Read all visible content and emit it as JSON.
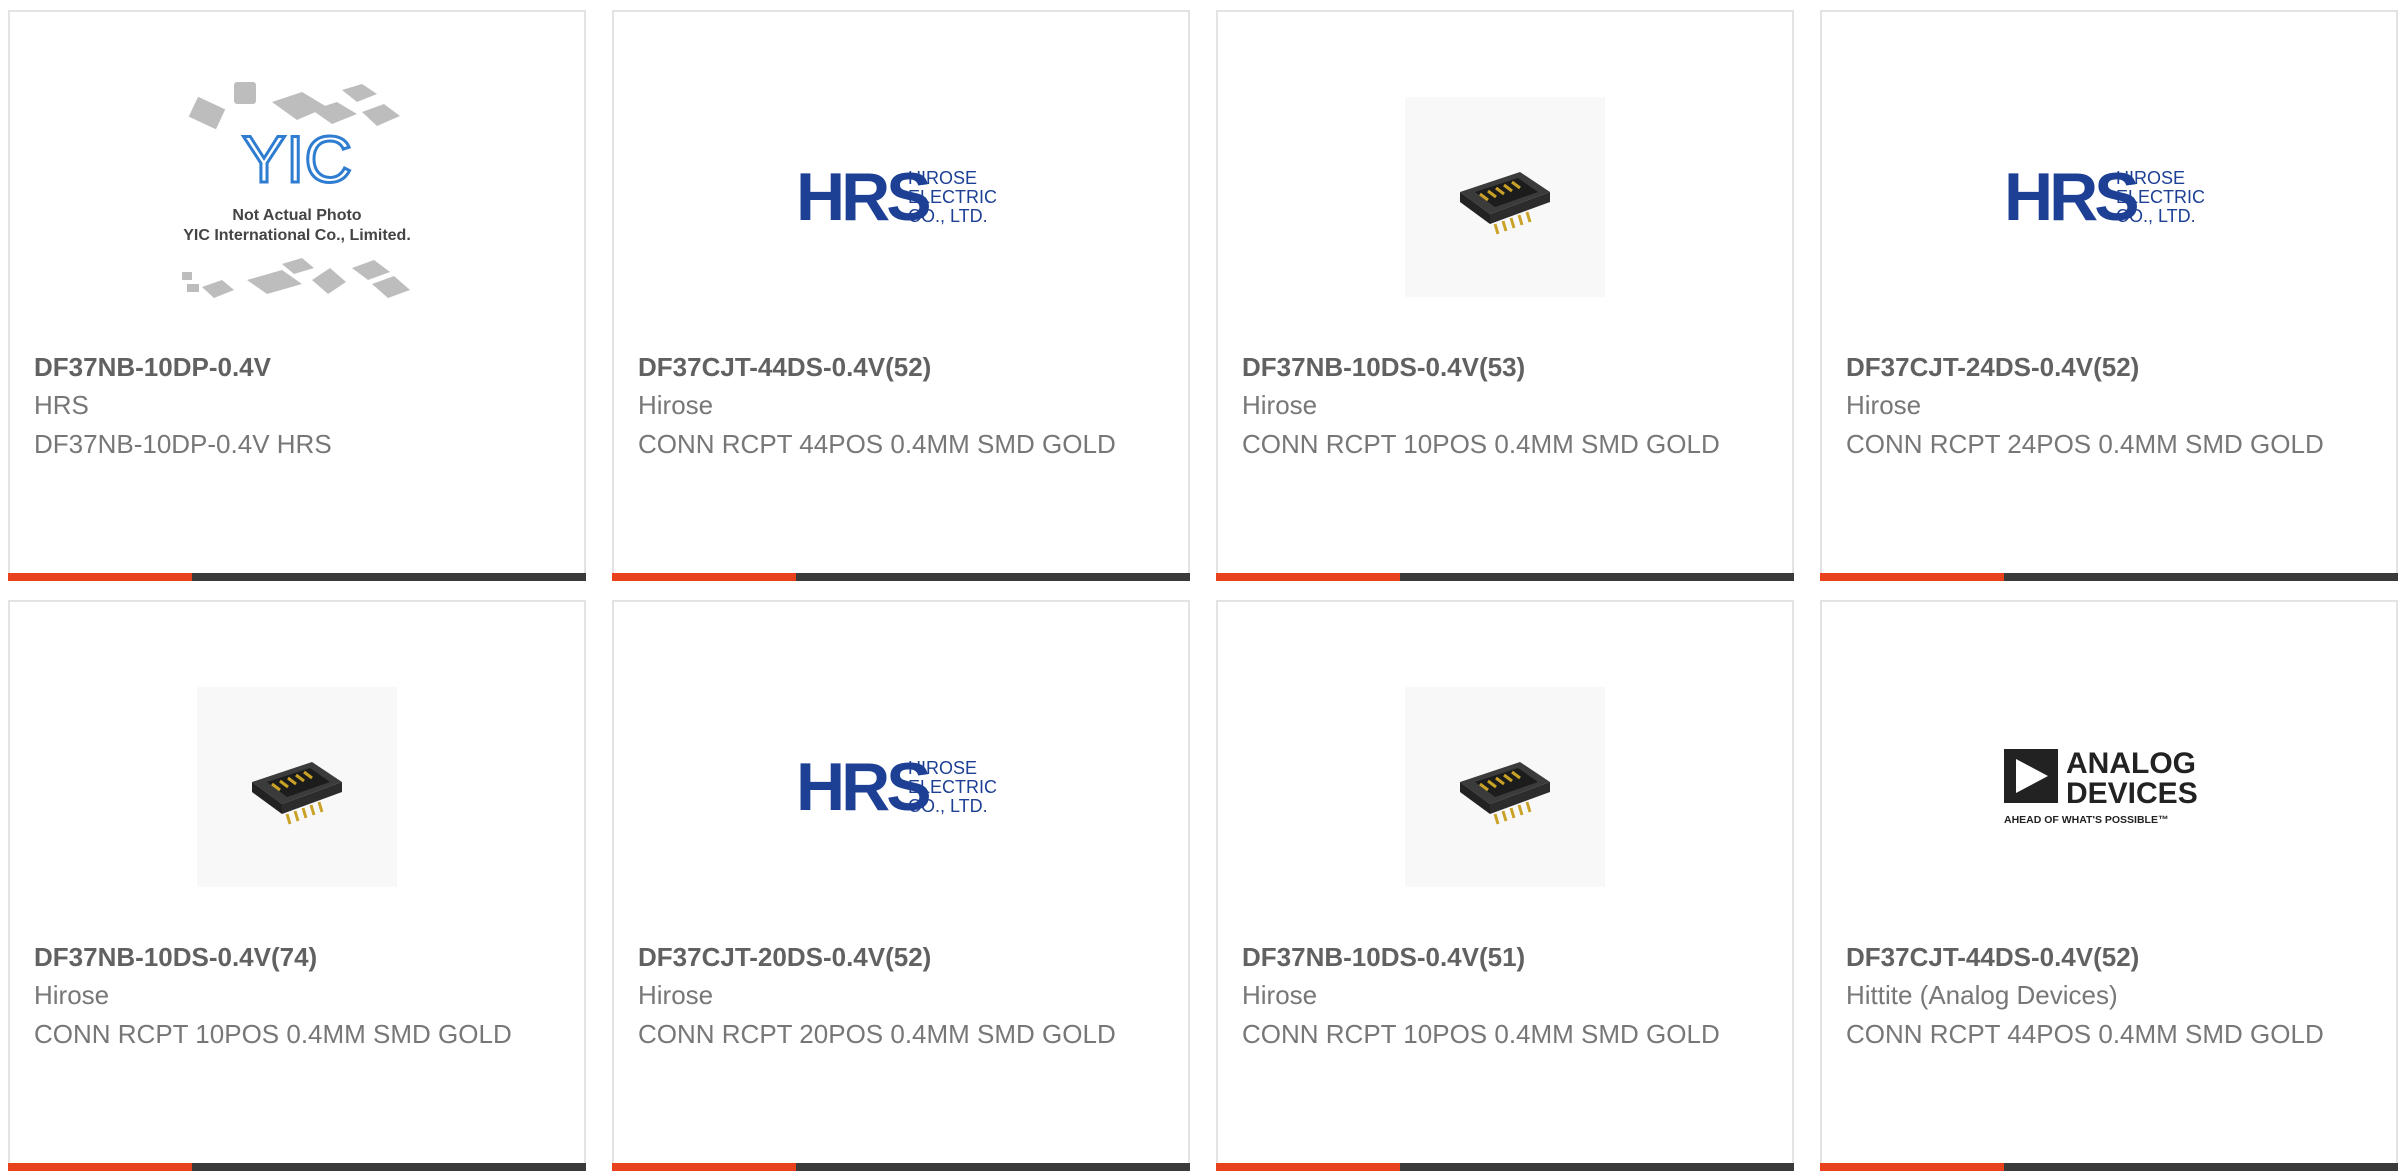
{
  "products": [
    {
      "name": "DF37NB-10DP-0.4V",
      "manufacturer": "HRS",
      "description": "DF37NB-10DP-0.4V HRS",
      "image": "placeholder"
    },
    {
      "name": "DF37CJT-44DS-0.4V(52)",
      "manufacturer": "Hirose",
      "description": "CONN RCPT 44POS 0.4MM SMD GOLD",
      "image": "hrs-logo"
    },
    {
      "name": "DF37NB-10DS-0.4V(53)",
      "manufacturer": "Hirose",
      "description": "CONN RCPT 10POS 0.4MM SMD GOLD",
      "image": "connector"
    },
    {
      "name": "DF37CJT-24DS-0.4V(52)",
      "manufacturer": "Hirose",
      "description": "CONN RCPT 24POS 0.4MM SMD GOLD",
      "image": "hrs-logo"
    },
    {
      "name": "DF37NB-10DS-0.4V(74)",
      "manufacturer": "Hirose",
      "description": "CONN RCPT 10POS 0.4MM SMD GOLD",
      "image": "connector"
    },
    {
      "name": "DF37CJT-20DS-0.4V(52)",
      "manufacturer": "Hirose",
      "description": "CONN RCPT 20POS 0.4MM SMD GOLD",
      "image": "hrs-logo"
    },
    {
      "name": "DF37NB-10DS-0.4V(51)",
      "manufacturer": "Hirose",
      "description": "CONN RCPT 10POS 0.4MM SMD GOLD",
      "image": "connector"
    },
    {
      "name": "DF37CJT-44DS-0.4V(52)",
      "manufacturer": "Hittite (Analog Devices)",
      "description": "CONN RCPT 44POS 0.4MM SMD GOLD",
      "image": "adi-logo"
    }
  ],
  "logos": {
    "placeholder": {
      "brand": "YIC",
      "line1": "Not Actual Photo",
      "line2": "YIC International Co., Limited."
    },
    "hrs": {
      "mark": "HRS",
      "line1": "HIROSE",
      "line2": "ELECTRIC",
      "line3": "CO., LTD."
    },
    "adi": {
      "line1": "ANALOG",
      "line2": "DEVICES",
      "tagline": "AHEAD OF WHAT'S POSSIBLE™"
    }
  },
  "colors": {
    "accent": "#e8411c",
    "bar": "#3a3a3a",
    "hrs_blue": "#1d3f94",
    "text_dark": "#616161",
    "text": "#777777"
  }
}
